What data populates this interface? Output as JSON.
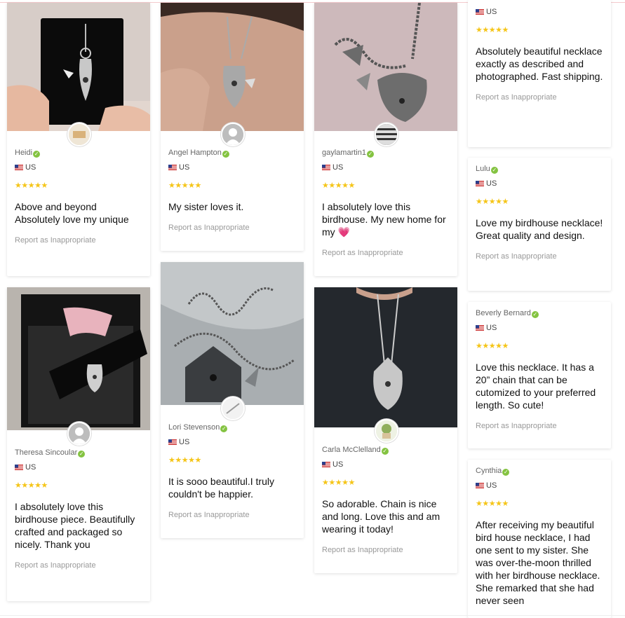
{
  "report_label": "Report as Inappropriate",
  "verified_mark": "✓",
  "stars": "★★★★★",
  "colors": {
    "star": "#f5c518",
    "verified": "#84c341",
    "accent_line": "#f3c9cc"
  },
  "reviews": [
    {
      "name": "Heidi",
      "country": "US",
      "text": "Above and beyond Absolutely love my unique"
    },
    {
      "name": "Angel Hampton",
      "country": "US",
      "text": "My sister loves it."
    },
    {
      "name": "gaylamartin1",
      "country": "US",
      "text": "I absolutely love this birdhouse. My new home for my",
      "emoji": "💗"
    },
    {
      "name": "",
      "country": "US",
      "text": "Absolutely beautiful necklace exactly as described and photographed. Fast shipping."
    },
    {
      "name": "Lulu",
      "country": "US",
      "text": "Love my birdhouse necklace! Great quality and design."
    },
    {
      "name": "Theresa Sincoular",
      "country": "US",
      "text": "I absolutely love this birdhouse piece. Beautifully crafted and packaged so nicely. Thank you"
    },
    {
      "name": "Lori Stevenson",
      "country": "US",
      "text": "It is sooo beautiful.I truly couldn't be happier."
    },
    {
      "name": "Carla McClelland",
      "country": "US",
      "text": "So adorable. Chain is nice and long. Love this and am wearing it today!"
    },
    {
      "name": "Beverly Bernard",
      "country": "US",
      "text": "Love this necklace. It has a 20” chain that can be cutomized to your preferred length. So cute!"
    },
    {
      "name": "Cynthia",
      "country": "US",
      "text": "After receiving my beautiful bird house necklace, I had one sent to my sister. She was over-the-moon thrilled with her birdhouse necklace. She remarked that she had never seen"
    }
  ]
}
